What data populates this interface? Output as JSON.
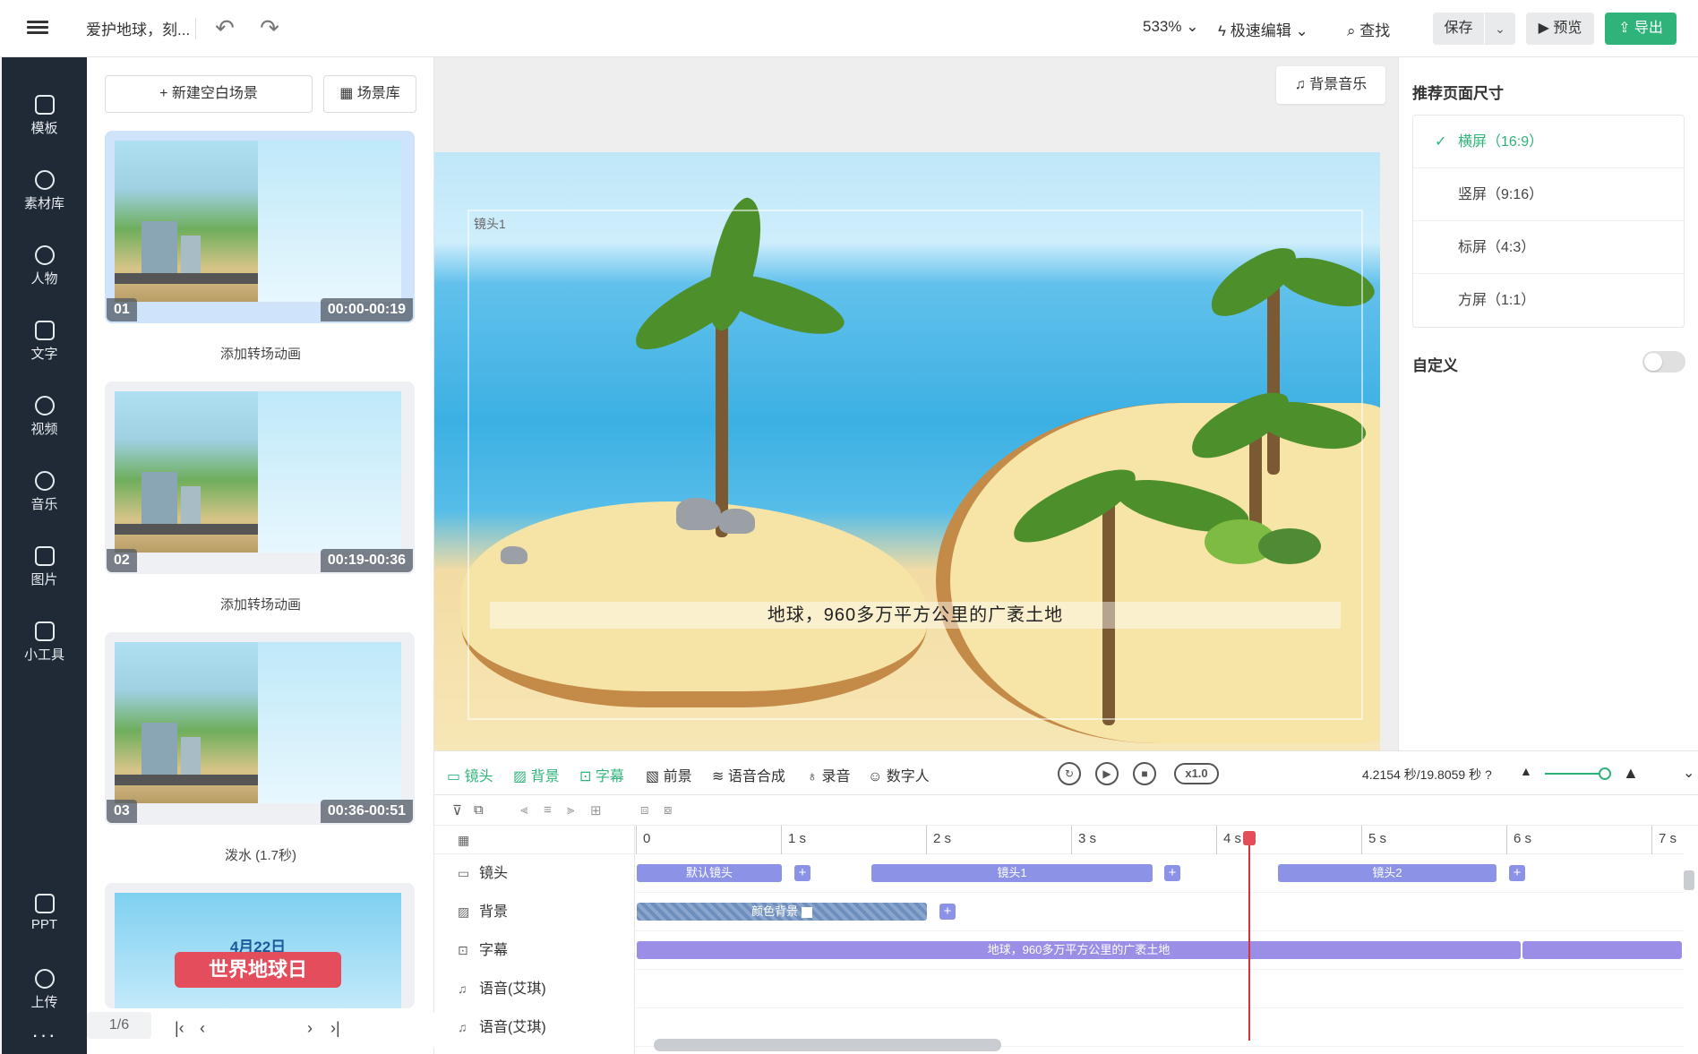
{
  "header": {
    "menu_icon": "hamburger-icon",
    "doc_title": "爱护地球，刻...",
    "undo_icon": "undo-icon",
    "redo_icon": "redo-icon",
    "zoom": "533%",
    "mode": "极速编辑",
    "find": "查找",
    "save": "保存",
    "preview": "预览",
    "export": "导出",
    "accent": "#2fb37a"
  },
  "sidebar": {
    "items": [
      {
        "label": "模板",
        "icon": "template-icon"
      },
      {
        "label": "素材库",
        "icon": "assets-icon"
      },
      {
        "label": "人物",
        "icon": "person-icon"
      },
      {
        "label": "文字",
        "icon": "text-icon"
      },
      {
        "label": "视频",
        "icon": "video-icon"
      },
      {
        "label": "音乐",
        "icon": "music-icon"
      },
      {
        "label": "图片",
        "icon": "image-icon"
      },
      {
        "label": "小工具",
        "icon": "tools-icon"
      },
      {
        "label": "PPT",
        "icon": "ppt-icon"
      },
      {
        "label": "上传",
        "icon": "upload-icon"
      }
    ],
    "more": "···"
  },
  "scenes_panel": {
    "new_blank": "+ 新建空白场景",
    "library": "场景库",
    "scenes": [
      {
        "num": "01",
        "time": "00:00-00:19",
        "transition": "添加转场动画"
      },
      {
        "num": "02",
        "time": "00:19-00:36",
        "transition": "添加转场动画"
      },
      {
        "num": "03",
        "time": "00:36-00:51",
        "transition": "泼水 (1.7秒)"
      },
      {
        "date": "4月22日",
        "banner": "世界地球日"
      }
    ],
    "pager": "1/6"
  },
  "canvas": {
    "bgm": "背景音乐",
    "shot_label": "镜头1",
    "subtitle": "地球，960多万平方公里的广袤土地"
  },
  "right_panel": {
    "title": "推荐页面尺寸",
    "options": [
      "横屏（16:9）",
      "竖屏（9:16）",
      "标屏（4:3）",
      "方屏（1:1）"
    ],
    "selected": 0,
    "custom": "自定义"
  },
  "timeline_bar": {
    "tools": [
      "镜头",
      "背景",
      "字幕",
      "前景",
      "语音合成",
      "录音",
      "数字人"
    ],
    "speed": "x1.0",
    "time": "4.2154 秒/19.8059 秒"
  },
  "timeline": {
    "ruler": [
      "0",
      "1 s",
      "2 s",
      "3 s",
      "4 s",
      "5 s",
      "6 s",
      "7 s"
    ],
    "tracks": [
      "镜头",
      "背景",
      "字幕",
      "语音(艾琪)",
      "语音(艾琪)"
    ],
    "shot_clips": [
      "默认镜头",
      "镜头1",
      "镜头2"
    ],
    "bg_clip": "颜色背景",
    "subtitle_clip": "地球，960多万平方公里的广袤土地"
  }
}
